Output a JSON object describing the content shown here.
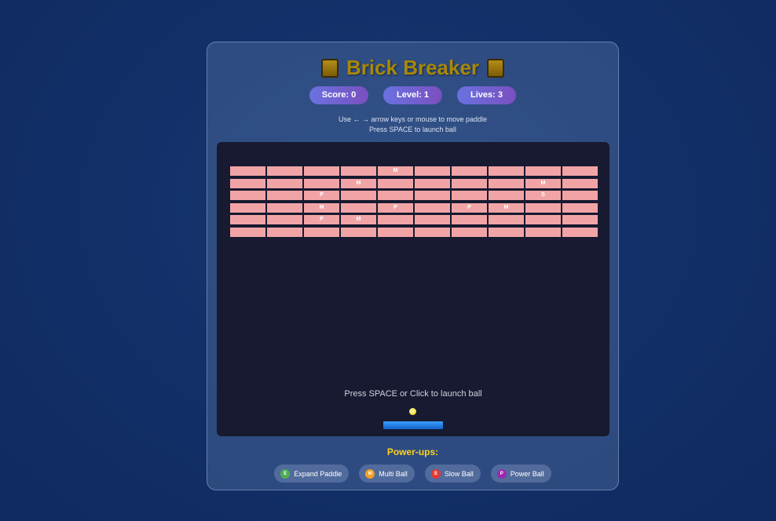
{
  "title": "Brick Breaker",
  "stats": {
    "score": "Score: 0",
    "level": "Level: 1",
    "lives": "Lives: 3"
  },
  "instructions": {
    "line1": "Use ← → arrow keys or mouse to move paddle",
    "line2": "Press SPACE to launch ball"
  },
  "game": {
    "launch_message": "Press SPACE or Click to launch ball",
    "brick_color": "#f1a4a6",
    "rows": [
      [
        "",
        "",
        "",
        "",
        "M",
        "",
        "",
        "",
        "",
        ""
      ],
      [
        "",
        "",
        "",
        "M",
        "",
        "",
        "",
        "",
        "M",
        ""
      ],
      [
        "",
        "",
        "P",
        "",
        "",
        "",
        "",
        "",
        "S",
        ""
      ],
      [
        "",
        "",
        "M",
        "",
        "P",
        "",
        "P",
        "M",
        "",
        ""
      ],
      [
        "",
        "",
        "P",
        "M",
        "",
        "",
        "",
        "",
        "",
        ""
      ],
      [
        "",
        "",
        "",
        "",
        "",
        "",
        "",
        "",
        "",
        ""
      ]
    ]
  },
  "powerups": {
    "title": "Power-ups:",
    "items": [
      {
        "letter": "E",
        "label": "Expand Paddle",
        "color": "#4caf50",
        "icon": "expand-icon"
      },
      {
        "letter": "M",
        "label": "Multi Ball",
        "color": "#f0a020",
        "icon": "multi-ball-icon"
      },
      {
        "letter": "S",
        "label": "Slow Ball",
        "color": "#e53935",
        "icon": "slow-ball-icon"
      },
      {
        "letter": "P",
        "label": "Power Ball",
        "color": "#9c27b0",
        "icon": "power-ball-icon"
      }
    ]
  }
}
